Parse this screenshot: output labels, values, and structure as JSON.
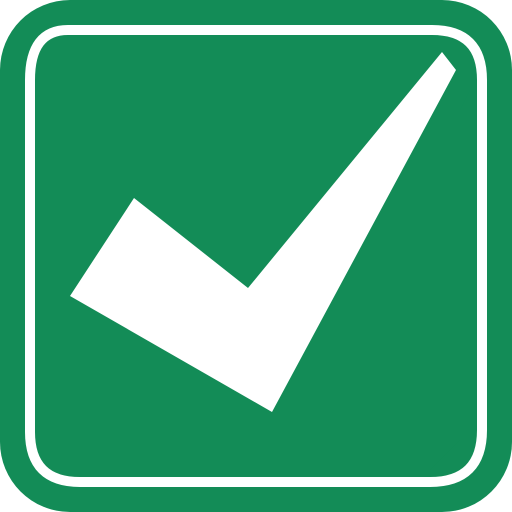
{
  "icon": {
    "name": "checkmark-icon",
    "state": "checked",
    "colors": {
      "background": "#138c57",
      "foreground": "#ffffff"
    }
  }
}
